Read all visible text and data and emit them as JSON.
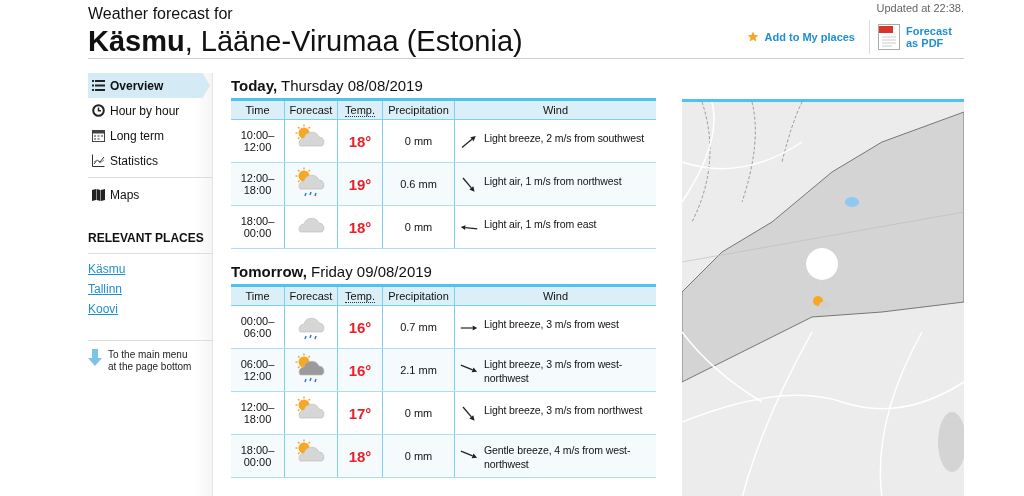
{
  "header": {
    "subtitle": "Weather forecast for",
    "title": "**Käsmu**, Lääne-Virumaa (Estonia)",
    "updated": "Updated at 22:38.",
    "add_place": "Add to My places",
    "pdf": "Forecast as PDF"
  },
  "sidebar": {
    "items": [
      {
        "label": "Overview",
        "kind": "list",
        "selected": true
      },
      {
        "label": "Hour by hour",
        "kind": "clock",
        "selected": false
      },
      {
        "label": "Long term",
        "kind": "calendar",
        "selected": false
      },
      {
        "label": "Statistics",
        "kind": "chart",
        "selected": false
      },
      {
        "label": "Maps",
        "kind": "map",
        "selected": false
      }
    ],
    "places_heading": "RELEVANT PLACES",
    "places": [
      "Käsmu",
      "Tallinn",
      "Koovi"
    ],
    "bottom_link": "To the main menu at the page bottom"
  },
  "days": [
    {
      "heading": "**Today,** Thursday 08/08/2019",
      "columns": [
        "Time",
        "Forecast",
        "Temp.",
        "Precipitation",
        "Wind"
      ],
      "rows": [
        {
          "time_from": "10:00–",
          "time_to": "12:00",
          "weather": {
            "kind": "sun_cloud"
          },
          "temp": "18°",
          "precipitation": "0 mm",
          "wind_arrow": {
            "kind": "sw"
          },
          "wind": "Light breeze, 2 m/s from southwest"
        },
        {
          "time_from": "12:00–",
          "time_to": "18:00",
          "weather": {
            "kind": "sun_cloud_rain"
          },
          "temp": "19°",
          "precipitation": "0.6 mm",
          "wind_arrow": {
            "kind": "nw"
          },
          "wind": "Light air, 1 m/s from northwest"
        },
        {
          "time_from": "18:00–",
          "time_to": "00:00",
          "weather": {
            "kind": "cloud"
          },
          "temp": "18°",
          "precipitation": "0 mm",
          "wind_arrow": {
            "kind": "e"
          },
          "wind": "Light air, 1 m/s from east"
        }
      ]
    },
    {
      "heading": "**Tomorrow,** Friday 09/08/2019",
      "columns": [
        "Time",
        "Forecast",
        "Temp.",
        "Precipitation",
        "Wind"
      ],
      "rows": [
        {
          "time_from": "00:00–",
          "time_to": "06:00",
          "weather": {
            "kind": "cloud_rain"
          },
          "temp": "16°",
          "precipitation": "0.7 mm",
          "wind_arrow": {
            "kind": "w"
          },
          "wind": "Light breeze, 3 m/s from west"
        },
        {
          "time_from": "06:00–",
          "time_to": "12:00",
          "weather": {
            "kind": "sun_darkcloud_rain"
          },
          "temp": "16°",
          "precipitation": "2.1 mm",
          "wind_arrow": {
            "kind": "wnw"
          },
          "wind": "Light breeze, 3 m/s from west-northwest"
        },
        {
          "time_from": "12:00–",
          "time_to": "18:00",
          "weather": {
            "kind": "sun_cloud"
          },
          "temp": "17°",
          "precipitation": "0 mm",
          "wind_arrow": {
            "kind": "nw"
          },
          "wind": "Light breeze, 3 m/s from northwest"
        },
        {
          "time_from": "18:00–",
          "time_to": "00:00",
          "weather": {
            "kind": "sun_cloud"
          },
          "temp": "18°",
          "precipitation": "0 mm",
          "wind_arrow": {
            "kind": "wnw"
          },
          "wind": "Gentle breeze, 4 m/s from west-northwest"
        }
      ]
    }
  ]
}
